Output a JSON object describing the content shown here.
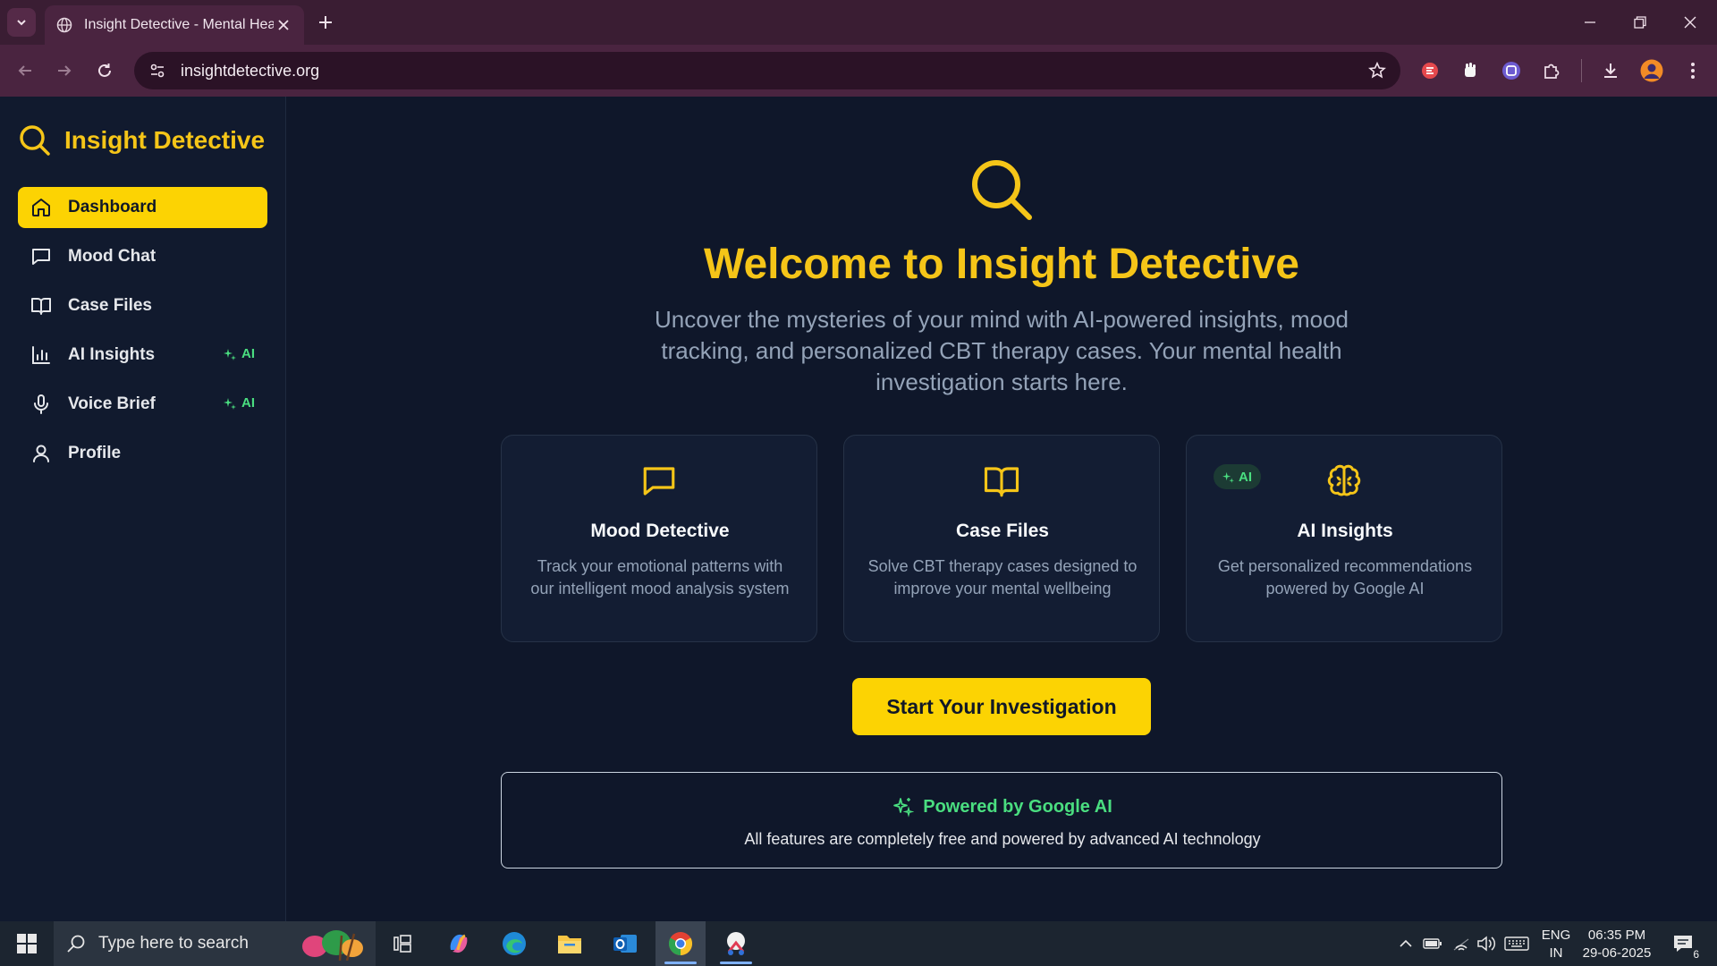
{
  "browser": {
    "tab_title": "Insight Detective - Mental Health",
    "url": "insightdetective.org"
  },
  "app": {
    "brand": "Insight Detective",
    "nav": [
      {
        "label": "Dashboard",
        "icon": "home-icon",
        "active": true
      },
      {
        "label": "Mood Chat",
        "icon": "message-square-icon"
      },
      {
        "label": "Case Files",
        "icon": "book-open-icon"
      },
      {
        "label": "AI Insights",
        "icon": "bar-chart-icon",
        "badge": "AI"
      },
      {
        "label": "Voice Brief",
        "icon": "microphone-icon",
        "badge": "AI"
      },
      {
        "label": "Profile",
        "icon": "user-icon"
      }
    ],
    "hero": {
      "title": "Welcome to Insight Detective",
      "subtitle": "Uncover the mysteries of your mind with AI-powered insights, mood tracking, and personalized CBT therapy cases. Your mental health investigation starts here."
    },
    "cards": [
      {
        "title": "Mood Detective",
        "desc": "Track your emotional patterns with our intelligent mood analysis system",
        "icon": "message-square-icon"
      },
      {
        "title": "Case Files",
        "desc": "Solve CBT therapy cases designed to improve your mental wellbeing",
        "icon": "book-open-icon"
      },
      {
        "title": "AI Insights",
        "desc": "Get personalized recommendations powered by Google AI",
        "icon": "brain-icon",
        "badge": "AI"
      }
    ],
    "cta": "Start Your Investigation",
    "powered": {
      "title": "Powered by Google AI",
      "text": "All features are completely free and powered by advanced AI technology"
    }
  },
  "taskbar": {
    "search_placeholder": "Type here to search",
    "lang_line1": "ENG",
    "lang_line2": "IN",
    "time": "06:35 PM",
    "date": "29-06-2025",
    "notifications": "6"
  },
  "colors": {
    "accent": "#fcd303",
    "background": "#0f172a",
    "ai_green": "#4ade80"
  }
}
